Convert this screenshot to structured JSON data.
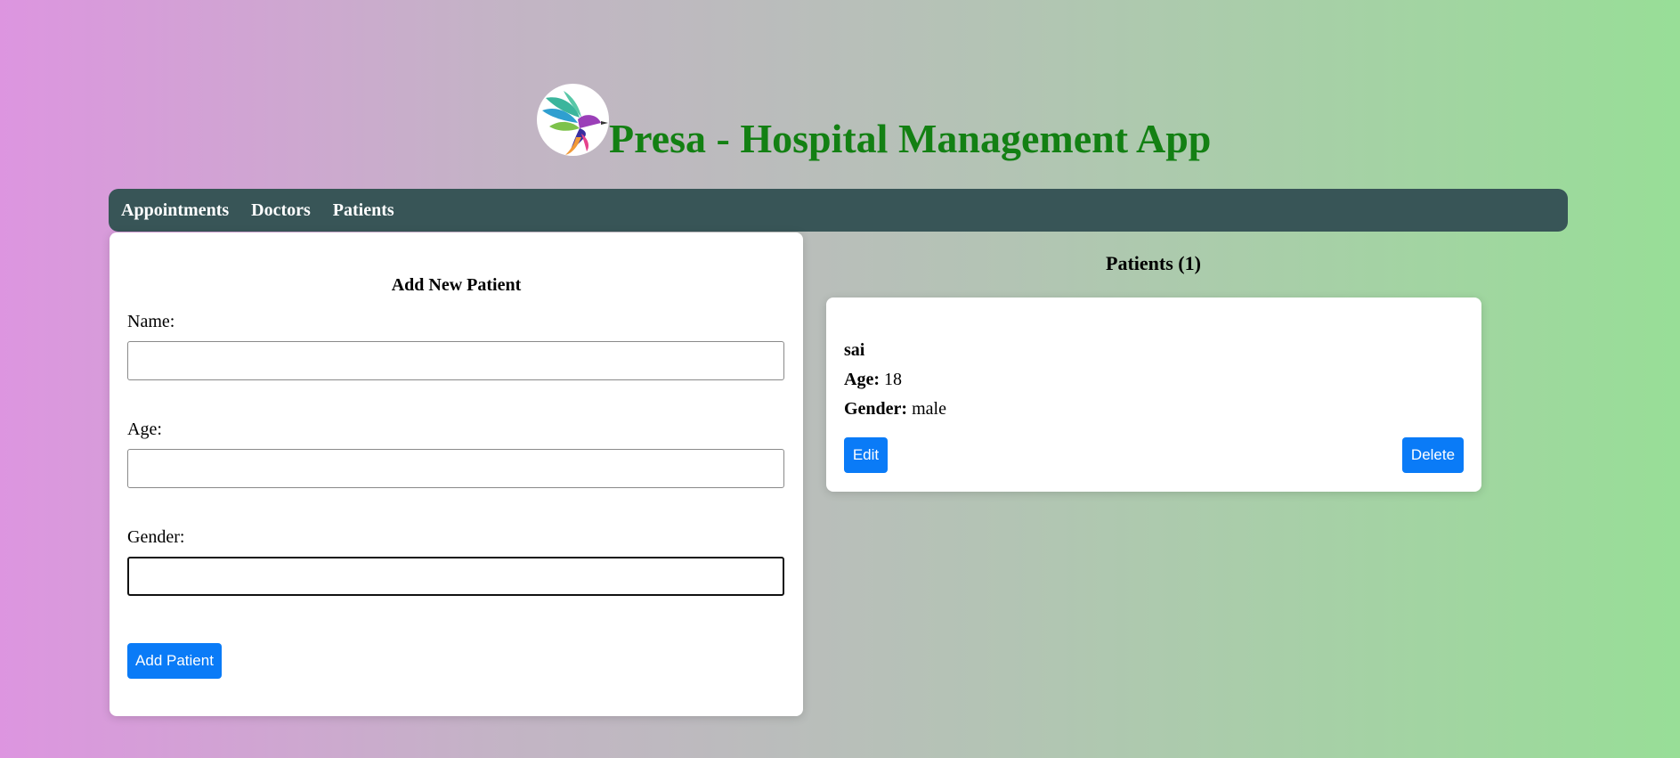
{
  "header": {
    "logo_icon": "hummingbird-logo",
    "title": "Presa - Hospital Management App"
  },
  "nav": {
    "items": [
      {
        "label": "Appointments"
      },
      {
        "label": "Doctors"
      },
      {
        "label": "Patients"
      }
    ]
  },
  "form": {
    "title": "Add New Patient",
    "name_label": "Name:",
    "name_value": "",
    "age_label": "Age:",
    "age_value": "",
    "gender_label": "Gender:",
    "gender_value": "",
    "submit_label": "Add Patient"
  },
  "patients": {
    "title": "Patients (1)",
    "list": [
      {
        "name": "sai",
        "age_label": "Age:",
        "age": "18",
        "gender_label": "Gender:",
        "gender": "male",
        "edit_label": "Edit",
        "delete_label": "Delete"
      }
    ]
  },
  "colors": {
    "title_green": "#138013",
    "nav_bg": "#385557",
    "button_blue": "#0a7bf7"
  }
}
